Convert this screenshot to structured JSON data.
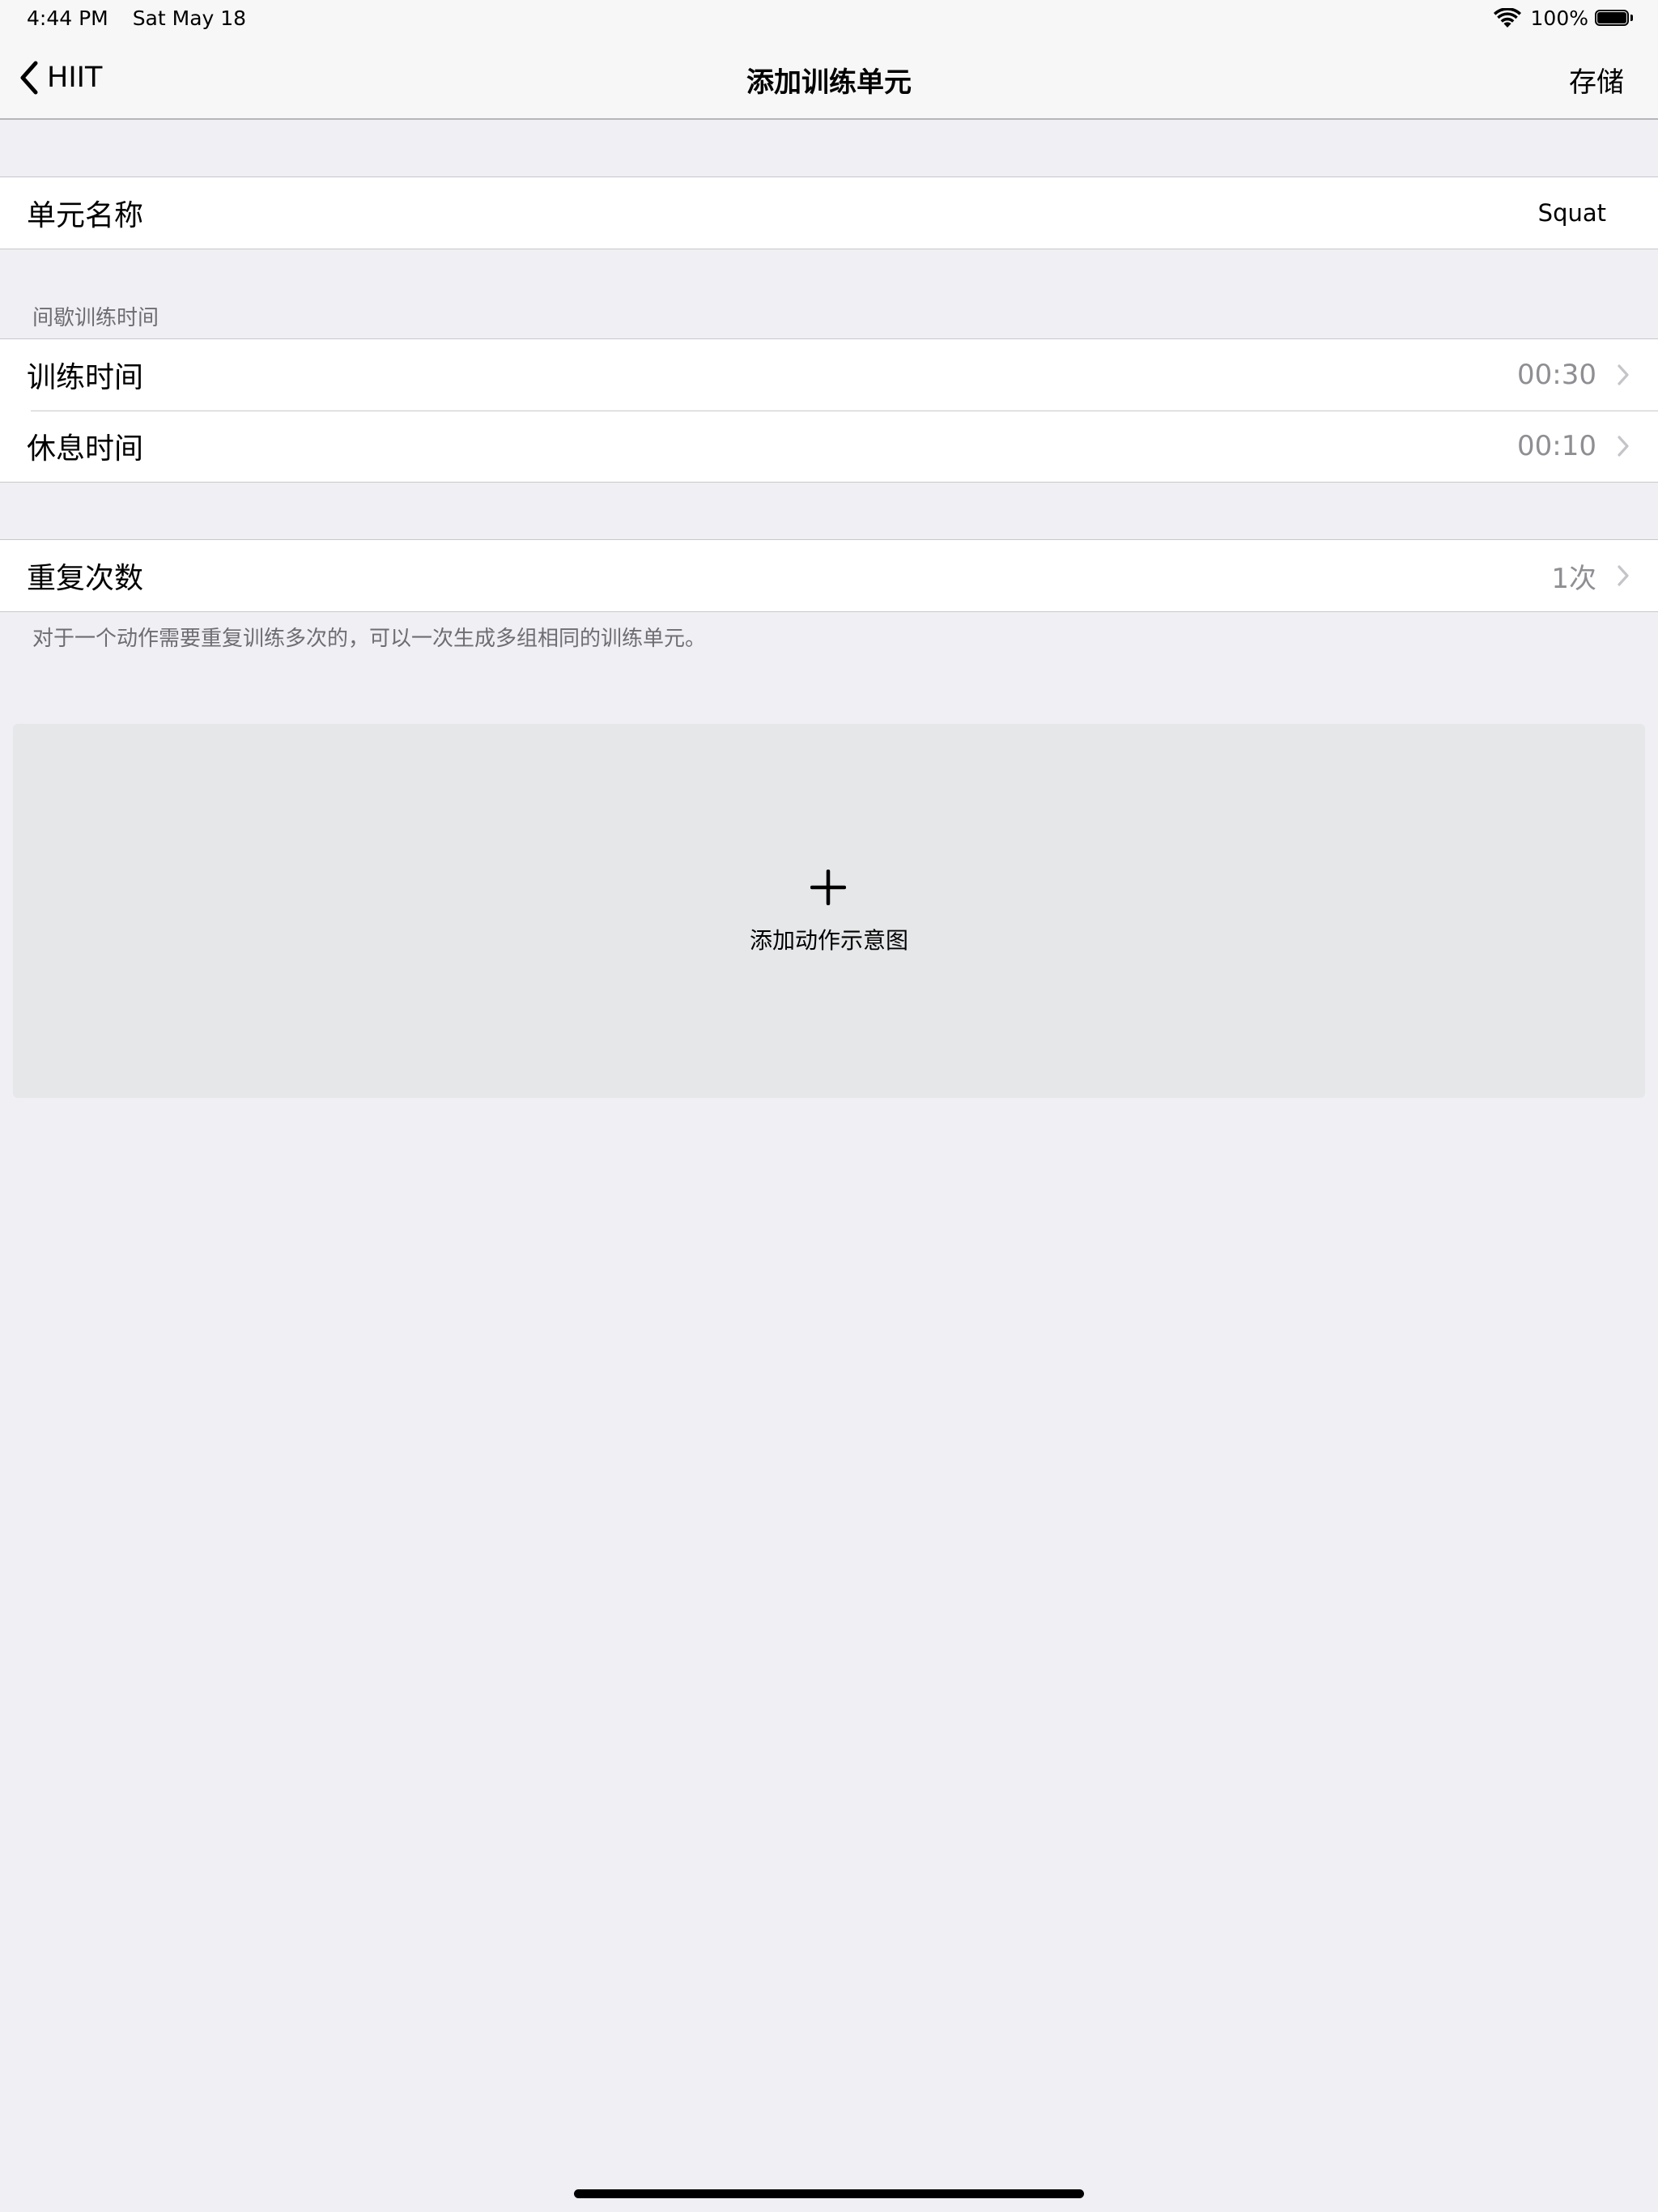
{
  "status_bar": {
    "time": "4:44 PM",
    "date": "Sat May 18",
    "battery_percent": "100%",
    "battery_level": 1.0
  },
  "nav": {
    "back_label": "HIIT",
    "title": "添加训练单元",
    "save_label": "存储"
  },
  "unit_name": {
    "label": "单元名称",
    "value": "Squat"
  },
  "interval": {
    "header": "间歇训练时间",
    "rows": [
      {
        "label": "训练时间",
        "value": "00:30"
      },
      {
        "label": "休息时间",
        "value": "00:10"
      }
    ]
  },
  "repeat": {
    "label": "重复次数",
    "value": "1次",
    "footer": "对于一个动作需要重复训练多次的，可以一次生成多组相同的训练单元。"
  },
  "image_placeholder": {
    "label": "添加动作示意图",
    "icon": "plus-icon"
  },
  "icons": {
    "back": "chevron-left-icon",
    "disclosure": "chevron-right-icon",
    "wifi": "wifi-icon",
    "battery": "battery-icon"
  }
}
